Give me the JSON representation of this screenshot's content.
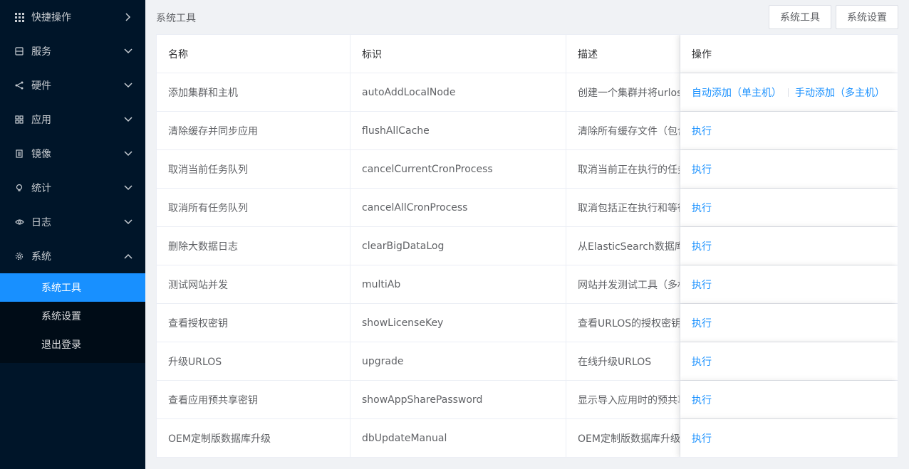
{
  "sidebar": {
    "menu": [
      {
        "label": "快捷操作",
        "icon": "grid-icon",
        "arrow": "right"
      },
      {
        "label": "服务",
        "icon": "server-icon",
        "arrow": "down"
      },
      {
        "label": "硬件",
        "icon": "share-icon",
        "arrow": "down"
      },
      {
        "label": "应用",
        "icon": "apps-icon",
        "arrow": "down"
      },
      {
        "label": "镜像",
        "icon": "document-icon",
        "arrow": "down"
      },
      {
        "label": "统计",
        "icon": "bulb-icon",
        "arrow": "down"
      },
      {
        "label": "日志",
        "icon": "eye-icon",
        "arrow": "down"
      },
      {
        "label": "系统",
        "icon": "gear-icon",
        "arrow": "up"
      }
    ],
    "submenu": [
      {
        "label": "系统工具",
        "active": true
      },
      {
        "label": "系统设置",
        "active": false
      },
      {
        "label": "退出登录",
        "active": false
      }
    ]
  },
  "header": {
    "title": "系统工具",
    "btn_tools": "系统工具",
    "btn_settings": "系统设置"
  },
  "table": {
    "columns": [
      "名称",
      "标识",
      "描述",
      "操作"
    ],
    "rows": [
      {
        "name": "添加集群和主机",
        "id": "autoAddLocalNode",
        "desc": "创建一个集群并将urlos所在",
        "actions": [
          "自动添加（单主机）",
          "手动添加（多主机）"
        ]
      },
      {
        "name": "清除缓存并同步应用",
        "id": "flushAllCache",
        "desc": "清除所有缓存文件（包含",
        "actions": [
          "执行"
        ]
      },
      {
        "name": "取消当前任务队列",
        "id": "cancelCurrentCronProcess",
        "desc": "取消当前正在执行的任务",
        "actions": [
          "执行"
        ]
      },
      {
        "name": "取消所有任务队列",
        "id": "cancelAllCronProcess",
        "desc": "取消包括正在执行和等待",
        "actions": [
          "执行"
        ]
      },
      {
        "name": "删除大数据日志",
        "id": "clearBigDataLog",
        "desc": "从ElasticSearch数据库中",
        "actions": [
          "执行"
        ]
      },
      {
        "name": "测试网站并发",
        "id": "multiAb",
        "desc": "网站并发测试工具（多机",
        "actions": [
          "执行"
        ]
      },
      {
        "name": "查看授权密钥",
        "id": "showLicenseKey",
        "desc": "查看URLOS的授权密钥",
        "actions": [
          "执行"
        ]
      },
      {
        "name": "升级URLOS",
        "id": "upgrade",
        "desc": "在线升级URLOS",
        "actions": [
          "执行"
        ]
      },
      {
        "name": "查看应用预共享密钥",
        "id": "showAppSharePassword",
        "desc": "显示导入应用时的预共享",
        "actions": [
          "执行"
        ]
      },
      {
        "name": "OEM定制版数据库升级",
        "id": "dbUpdateManual",
        "desc": "OEM定制版数据库升级",
        "actions": [
          "执行"
        ]
      }
    ]
  },
  "colors": {
    "sidebar_bg": "#001529",
    "submenu_bg": "#000c17",
    "accent": "#1890ff",
    "page_bg": "#f0f2f5"
  }
}
